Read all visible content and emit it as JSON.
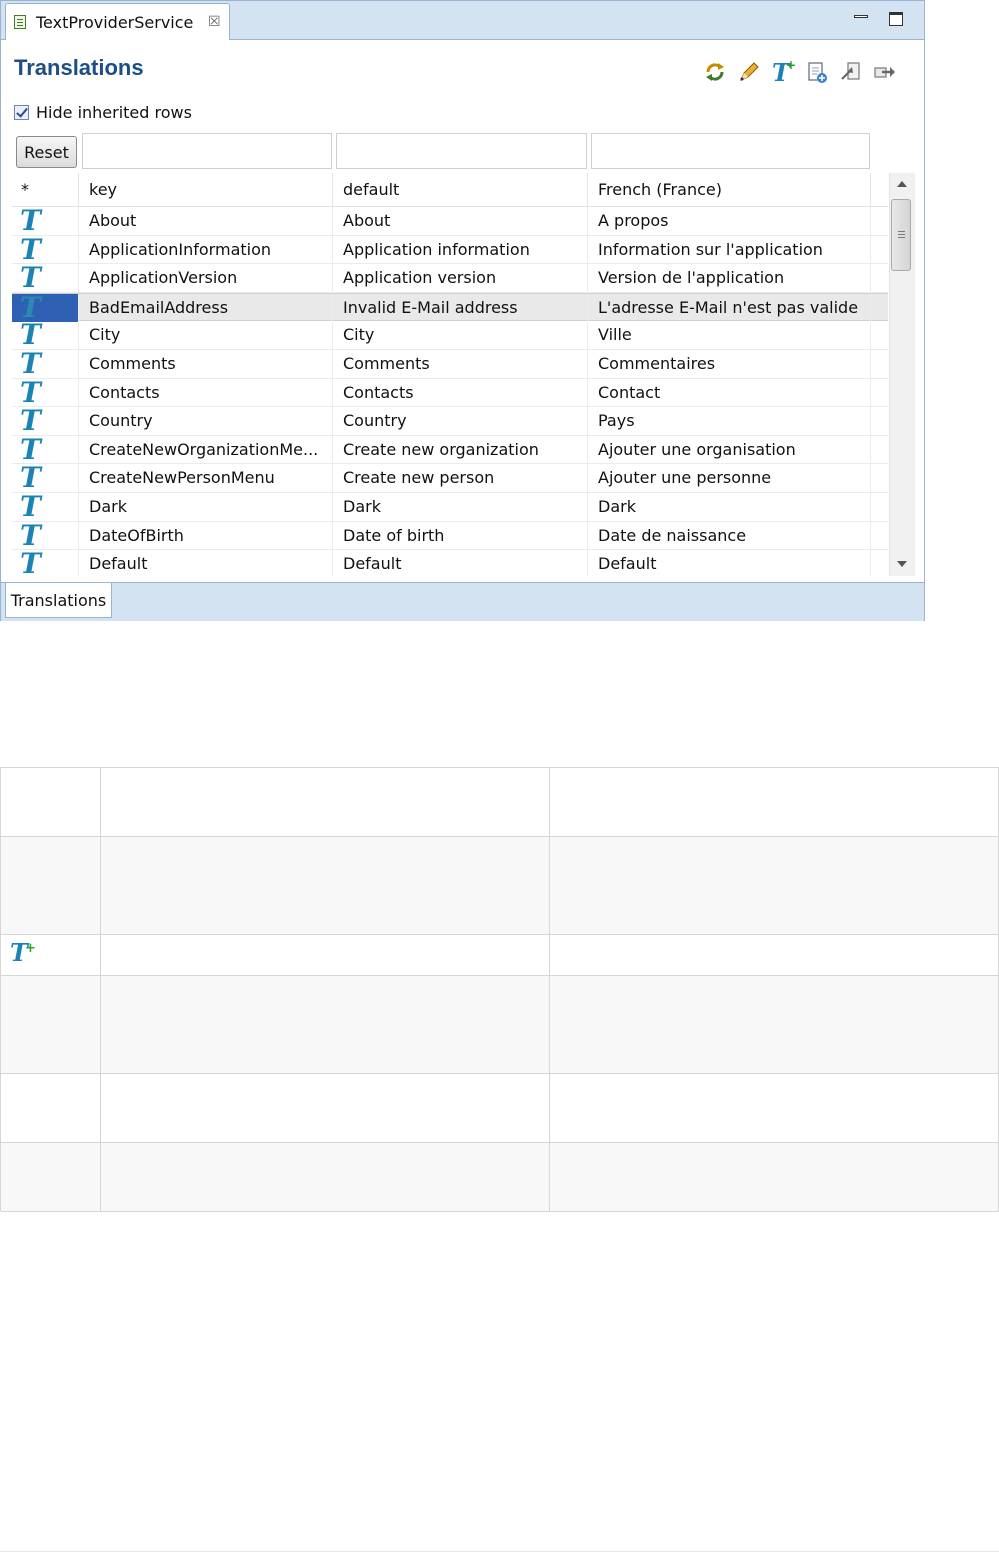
{
  "editor": {
    "tab_title": "TextProviderService",
    "close_glyph": "☒",
    "section_title": "Translations",
    "hide_inherited_label": "Hide inherited rows",
    "hide_inherited_checked": true,
    "reset_label": "Reset",
    "toolbar": [
      "refresh-icon",
      "edit-pencil-icon",
      "add-text-icon",
      "new-document-icon",
      "import-icon",
      "export-icon"
    ],
    "bottom_tab_label": "Translations"
  },
  "table": {
    "headers": [
      "*",
      "key",
      "default",
      "French (France)"
    ],
    "selected_index": 3,
    "rows": [
      {
        "key": "About",
        "default": "About",
        "french": "A propos"
      },
      {
        "key": "ApplicationInformation",
        "default": "Application information",
        "french": "Information sur l'application"
      },
      {
        "key": "ApplicationVersion",
        "default": "Application version",
        "french": "Version de l'application"
      },
      {
        "key": "BadEmailAddress",
        "default": "Invalid E-Mail address",
        "french": "L'adresse E-Mail n'est pas valide"
      },
      {
        "key": "City",
        "default": "City",
        "french": "Ville"
      },
      {
        "key": "Comments",
        "default": "Comments",
        "french": "Commentaires"
      },
      {
        "key": "Contacts",
        "default": "Contacts",
        "french": "Contact"
      },
      {
        "key": "Country",
        "default": "Country",
        "french": "Pays"
      },
      {
        "key": "CreateNewOrganizationMe...",
        "default": "Create new organization",
        "french": "Ajouter une organisation"
      },
      {
        "key": "CreateNewPersonMenu",
        "default": "Create new person",
        "french": "Ajouter une personne"
      },
      {
        "key": "Dark",
        "default": "Dark",
        "french": "Dark"
      },
      {
        "key": "DateOfBirth",
        "default": "Date of birth",
        "french": "Date de naissance"
      },
      {
        "key": "Default",
        "default": "Default",
        "french": "Default"
      }
    ],
    "row_icon_glyph": "T"
  },
  "doc_table": {
    "icon_glyph": "T",
    "icon_plus": "+",
    "icon_row_index": 2
  },
  "colors": {
    "title_blue": "#1e4e86",
    "icon_teal": "#1c84b4",
    "tab_bar": "#d4e3f1",
    "selection": "#2e60b4"
  }
}
